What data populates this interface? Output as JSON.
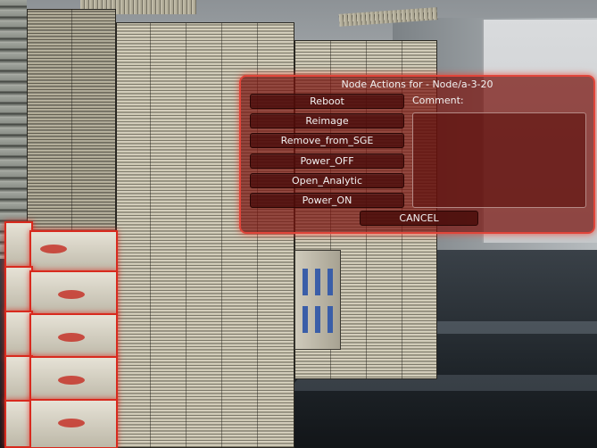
{
  "dialog": {
    "title": "Node Actions for - Node/a-3-20",
    "buttons": [
      {
        "label": "Reboot"
      },
      {
        "label": "Reimage"
      },
      {
        "label": "Remove_from_SGE"
      },
      {
        "label": "Power_OFF"
      },
      {
        "label": "Open_Analytic"
      },
      {
        "label": "Power_ON"
      }
    ],
    "comment_label": "Comment:",
    "comment_value": "",
    "cancel_label": "CANCEL"
  },
  "colors": {
    "dialog_bg": "#781410",
    "dialog_border": "#e0453a",
    "highlight_red": "#d82a1e"
  }
}
